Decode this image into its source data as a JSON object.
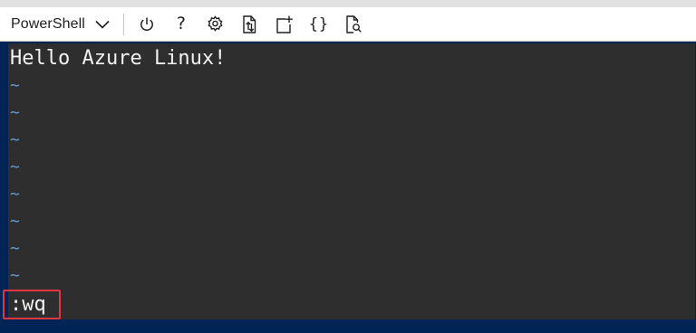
{
  "toolbar": {
    "shell_label": "PowerShell",
    "icons": [
      "chevron-down-icon",
      "power-icon",
      "help-icon",
      "settings-icon",
      "upload-download-files-icon",
      "new-session-icon",
      "editor-braces-icon",
      "web-preview-icon"
    ],
    "help_glyph": "?",
    "braces_glyph": "{}"
  },
  "terminal": {
    "first_line": "Hello Azure Linux!",
    "empty_line_marker": "~",
    "empty_line_count": 8,
    "command": ":wq"
  },
  "colors": {
    "terminal_bg": "#2e2e2e",
    "page_bg": "#012456",
    "tilde": "#5f9bd3",
    "highlight": "#e0383e"
  }
}
